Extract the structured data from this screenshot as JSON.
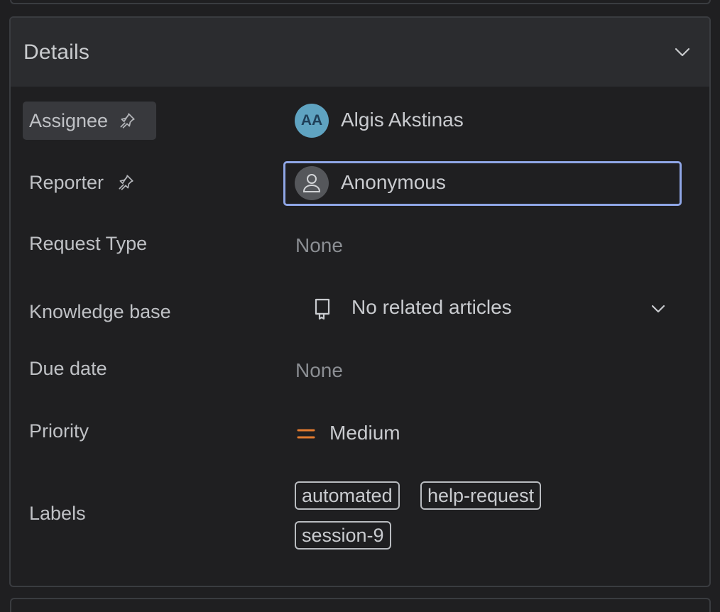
{
  "details": {
    "title": "Details"
  },
  "fields": {
    "assignee": {
      "label": "Assignee",
      "initials": "AA",
      "name": "Algis Akstinas"
    },
    "reporter": {
      "label": "Reporter",
      "name": "Anonymous"
    },
    "request_type": {
      "label": "Request Type",
      "value": "None"
    },
    "knowledge_base": {
      "label": "Knowledge base",
      "value": "No related articles"
    },
    "due_date": {
      "label": "Due date",
      "value": "None"
    },
    "priority": {
      "label": "Priority",
      "value": "Medium",
      "color": "#e07a2f"
    },
    "labels": {
      "label": "Labels",
      "tags": [
        "automated",
        "help-request",
        "session-9"
      ]
    }
  },
  "icons": {
    "pin": "pin-icon",
    "chevron": "chevron-down-icon",
    "person": "person-icon",
    "book": "knowledge-base-icon",
    "priority": "priority-medium-icon"
  },
  "colors": {
    "focus_ring": "#8fa6e6",
    "avatar_bg": "#5fa3c1"
  }
}
